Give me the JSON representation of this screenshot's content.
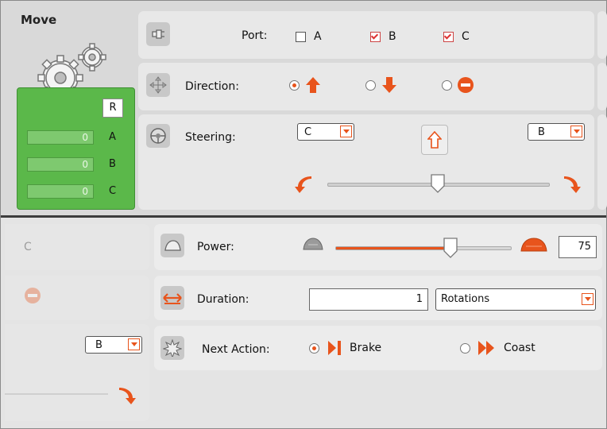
{
  "block": {
    "title": "Move"
  },
  "feedback": {
    "reset_label": "R",
    "rows": [
      {
        "value": "0",
        "port": "A"
      },
      {
        "value": "0",
        "port": "B"
      },
      {
        "value": "0",
        "port": "C"
      }
    ]
  },
  "port": {
    "label": "Port:",
    "options": [
      {
        "name": "A",
        "checked": false
      },
      {
        "name": "B",
        "checked": true
      },
      {
        "name": "C",
        "checked": true
      }
    ]
  },
  "direction": {
    "label": "Direction:",
    "selected": "forward",
    "options": [
      "forward",
      "backward",
      "stop"
    ]
  },
  "steering": {
    "label": "Steering:",
    "left_port": "C",
    "right_port": "B",
    "slider_level": 0.5
  },
  "power": {
    "label": "Power:",
    "value": "75",
    "slider_level": 0.75
  },
  "duration": {
    "label": "Duration:",
    "value": "1",
    "unit": "Rotations"
  },
  "next_action": {
    "label": "Next Action:",
    "options": [
      "Brake",
      "Coast"
    ],
    "selected": "Brake"
  },
  "lower_left_ghost": {
    "port_letter": "C",
    "dropdown_value": "B"
  },
  "colors": {
    "accent": "#e8541c",
    "green_panel": "#5bb84a",
    "background": "#e9e9e9"
  }
}
